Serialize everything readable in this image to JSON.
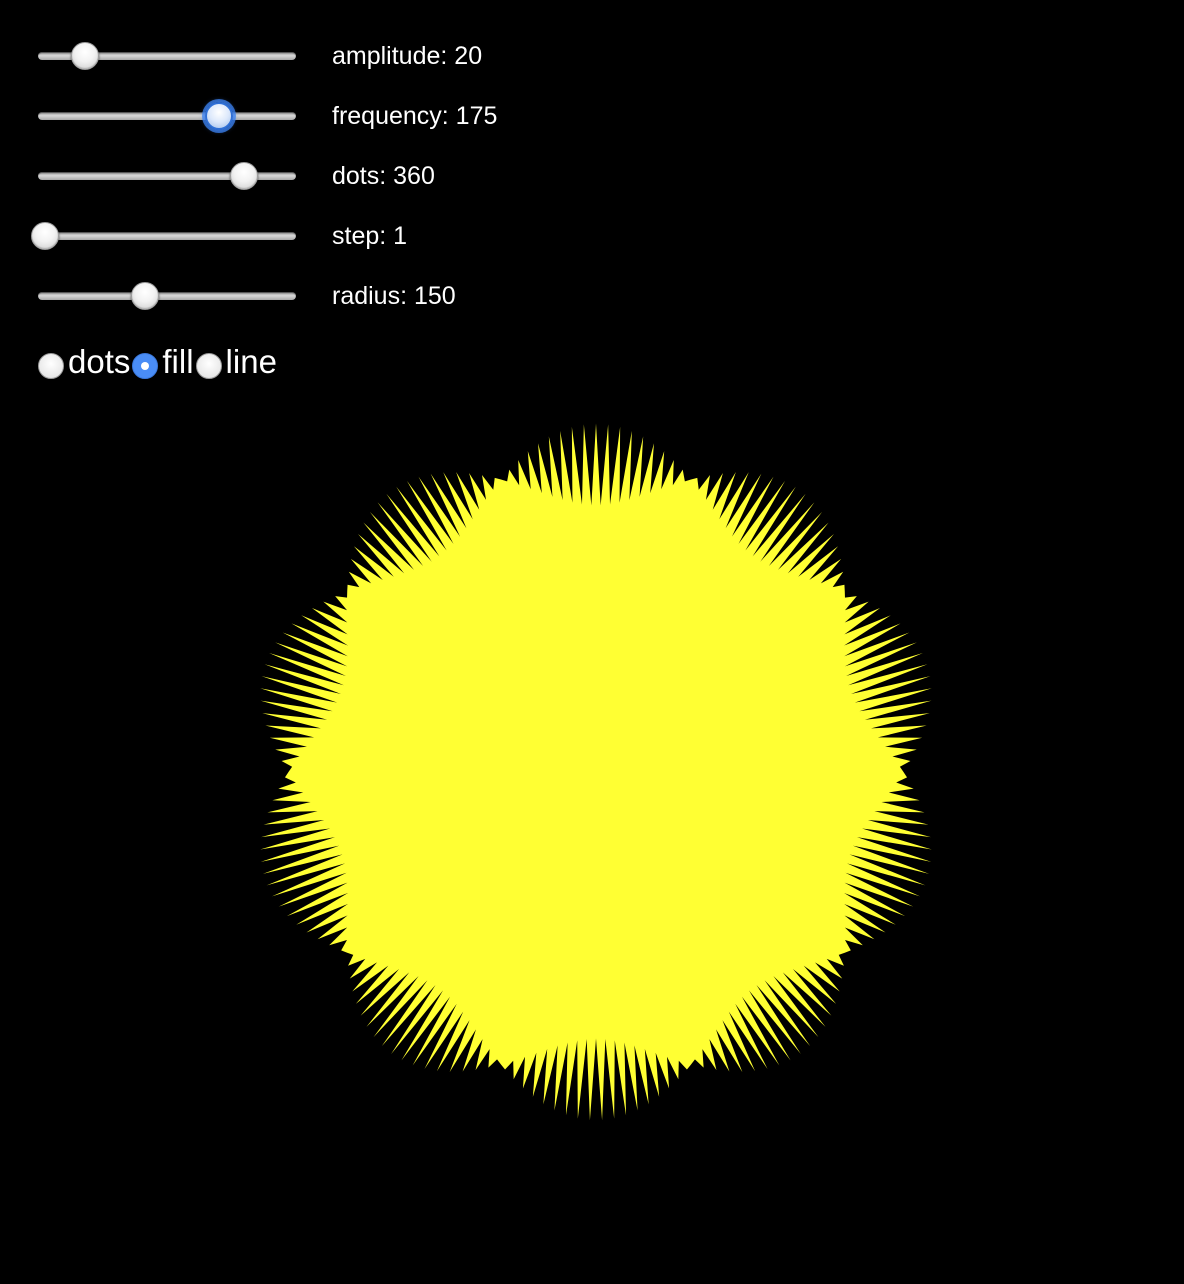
{
  "sliders": [
    {
      "id": "amplitude",
      "label": "amplitude: 20",
      "value": 20,
      "min": 0,
      "max": 100,
      "focused": false
    },
    {
      "id": "frequency",
      "label": "frequency: 175",
      "value": 175,
      "min": 0,
      "max": 200,
      "focused": true
    },
    {
      "id": "dots",
      "label": "dots: 360",
      "value": 360,
      "min": 1,
      "max": 360,
      "focused": false
    },
    {
      "id": "step",
      "label": "step: 1",
      "value": 1,
      "min": 1,
      "max": 50,
      "focused": false
    },
    {
      "id": "radius",
      "label": "radius: 150",
      "value": 150,
      "min": 0,
      "max": 300,
      "focused": false
    }
  ],
  "mode": {
    "options": [
      {
        "id": "dots",
        "label": "dots",
        "checked": false
      },
      {
        "id": "fill",
        "label": "fill",
        "checked": true
      },
      {
        "id": "line",
        "label": "line",
        "checked": false
      }
    ]
  },
  "shape": {
    "fill_color": "#FFFF33",
    "background_color": "#000000",
    "accent_color": "#4A8DF6"
  }
}
